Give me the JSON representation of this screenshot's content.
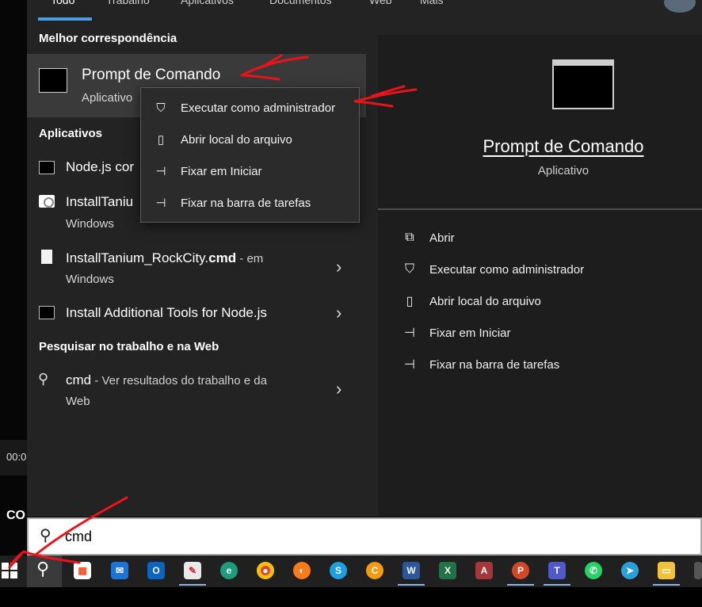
{
  "tabs": [
    "Todo",
    "Trabalho",
    "Aplicativos",
    "Documentos",
    "Web",
    "Mais"
  ],
  "best_match": {
    "header": "Melhor correspondência",
    "title": "Prompt de Comando",
    "subtitle": "Aplicativo"
  },
  "apps": {
    "header": "Aplicativos",
    "items": [
      {
        "title": "Node.js cor",
        "subtitle": "",
        "icon": "cmd-icon"
      },
      {
        "title": "InstallTaniu",
        "subtitle": "Windows",
        "icon": "tanium-icon"
      },
      {
        "title": "InstallTanium_RockCity.",
        "title_bold": "cmd",
        "title_suffix": " - em",
        "subtitle": "Windows",
        "icon": "document-icon"
      },
      {
        "title": "Install Additional Tools for Node.js",
        "subtitle": "",
        "icon": "cmd-icon"
      }
    ]
  },
  "web": {
    "header": "Pesquisar no trabalho e na Web",
    "query": "cmd",
    "suffix": " - Ver resultados do trabalho e da",
    "subtitle": "Web"
  },
  "context_menu": [
    {
      "label": "Executar como administrador",
      "icon": "shield-icon"
    },
    {
      "label": "Abrir local do arquivo",
      "icon": "folder-icon"
    },
    {
      "label": "Fixar em Iniciar",
      "icon": "pin-icon"
    },
    {
      "label": "Fixar na barra de tarefas",
      "icon": "pin-icon"
    }
  ],
  "details": {
    "title": "Prompt de Comando",
    "subtitle": "Aplicativo",
    "actions": [
      {
        "label": "Abrir",
        "icon": "open-icon"
      },
      {
        "label": "Executar como administrador",
        "icon": "shield-icon"
      },
      {
        "label": "Abrir local do arquivo",
        "icon": "folder-icon"
      },
      {
        "label": "Fixar em Iniciar",
        "icon": "pin-icon"
      },
      {
        "label": "Fixar na barra de tarefas",
        "icon": "pin-icon"
      }
    ]
  },
  "search": {
    "value": "cmd"
  },
  "desktop": {
    "time": "00:0",
    "text": "CO"
  },
  "taskbar": {
    "apps": [
      "Microsoft Store",
      "Mail",
      "Outlook",
      "Paint",
      "Edge",
      "Chrome",
      "Firefox",
      "Skype",
      "C App",
      "Word",
      "Excel",
      "Access",
      "PowerPoint",
      "Teams",
      "WhatsApp",
      "Telegram",
      "File Explorer",
      "Other"
    ]
  },
  "colors": {
    "accent": "#4a9fe0",
    "annotation": "#e8141a"
  }
}
